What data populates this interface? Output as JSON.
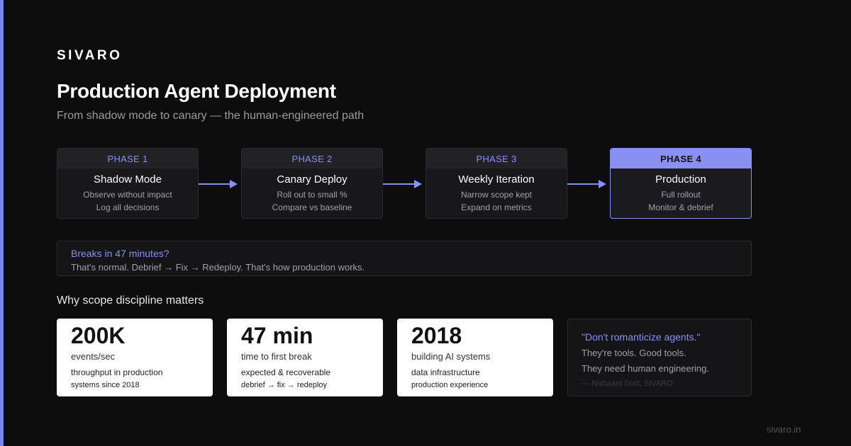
{
  "brand": "SIVARO",
  "title": "Production Agent Deployment",
  "subtitle": "From shadow mode to canary — the human-engineered path",
  "colors": {
    "accent": "#8a8ff2",
    "background": "#0d0d0d",
    "card": "#18181b",
    "stat_card": "#ffffff"
  },
  "phases": [
    {
      "label": "PHASE 1",
      "name": "Shadow Mode",
      "line1": "Observe without impact",
      "line2": "Log all decisions"
    },
    {
      "label": "PHASE 2",
      "name": "Canary Deploy",
      "line1": "Roll out to small %",
      "line2": "Compare vs baseline"
    },
    {
      "label": "PHASE 3",
      "name": "Weekly Iteration",
      "line1": "Narrow scope kept",
      "line2": "Expand on metrics"
    },
    {
      "label": "PHASE 4",
      "name": "Production",
      "line1": "Full rollout",
      "line2": "Monitor & debrief"
    }
  ],
  "active_phase": "PHASE 4",
  "arrow_icon": "arrow-right-icon",
  "callout": {
    "title": "Breaks in 47 minutes?",
    "text": "That's normal. Debrief → Fix → Redeploy. That's how production works."
  },
  "section_title": "Why scope discipline matters",
  "stats": [
    {
      "value": "200K",
      "label": "events/sec",
      "line1": "throughput in production",
      "line2": "systems since 2018"
    },
    {
      "value": "47 min",
      "label": "time to first break",
      "line1": "expected & recoverable",
      "line2": "debrief → fix → redeploy"
    },
    {
      "value": "2018",
      "label": "building AI systems",
      "line1": "data infrastructure",
      "line2": "production experience"
    }
  ],
  "quote": {
    "headline": "\"Don't romanticize agents.\"",
    "line1": "They're tools. Good tools.",
    "line2": "They need human engineering.",
    "attribution": "— Nishaant Dixit, SIVARO"
  },
  "footer": "sivaro.in"
}
